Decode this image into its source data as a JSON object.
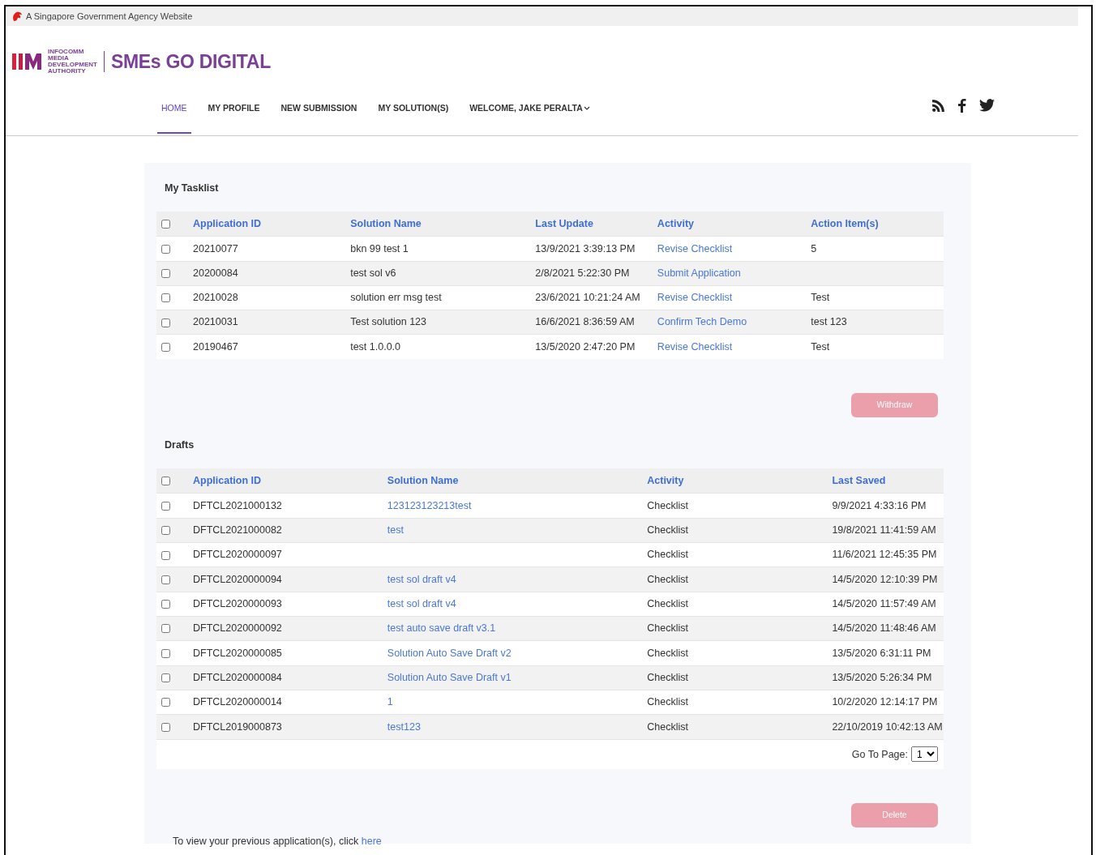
{
  "gov_bar": {
    "text": "A Singapore Government Agency Website"
  },
  "logo": {
    "agency_lines": [
      "INFOCOMM",
      "MEDIA",
      "DEVELOPMENT",
      "AUTHORITY"
    ],
    "site_title": "SMEs GO DIGITAL"
  },
  "nav": [
    {
      "label": "HOME",
      "selected": true,
      "kind": "link"
    },
    {
      "label": "MY PROFILE",
      "selected": false,
      "kind": "link"
    },
    {
      "label": "NEW SUBMISSION",
      "selected": false,
      "kind": "link"
    },
    {
      "label": "MY SOLUTION(S)",
      "selected": false,
      "kind": "link"
    },
    {
      "label": "WELCOME, JAKE PERALTA",
      "selected": false,
      "kind": "dropdown"
    }
  ],
  "tasklist": {
    "title": "My Tasklist",
    "header_checked": false,
    "columns": [
      {
        "label": "Application ID",
        "kind": "text"
      },
      {
        "label": "Solution Name",
        "kind": "text"
      },
      {
        "label": "Last Update",
        "kind": "text"
      },
      {
        "label": "Activity",
        "kind": "link"
      },
      {
        "label": "Action Item(s)",
        "kind": "text"
      }
    ],
    "rows": [
      {
        "checked": false,
        "cells": [
          "20210077",
          "bkn 99 test 1",
          "13/9/2021 3:39:13 PM",
          "Revise Checklist",
          "5"
        ]
      },
      {
        "checked": false,
        "cells": [
          "20200084",
          "test sol v6",
          "2/8/2021 5:22:30 PM",
          "Submit Application",
          ""
        ]
      },
      {
        "checked": false,
        "cells": [
          "20210028",
          "solution err msg test",
          "23/6/2021 10:21:24 AM",
          "Revise Checklist",
          "Test"
        ]
      },
      {
        "checked": false,
        "cells": [
          "20210031",
          "Test solution 123",
          "16/6/2021 8:36:59 AM",
          "Confirm Tech Demo",
          "test 123"
        ]
      },
      {
        "checked": false,
        "cells": [
          "20190467",
          "test 1.0.0.0",
          "13/5/2020 2:47:20 PM",
          "Revise Checklist",
          "Test"
        ]
      }
    ],
    "button": {
      "label": "Withdraw",
      "disabled": true
    }
  },
  "drafts": {
    "title": "Drafts",
    "header_checked": false,
    "columns": [
      {
        "label": "Application ID",
        "kind": "text"
      },
      {
        "label": "Solution Name",
        "kind": "link"
      },
      {
        "label": "Activity",
        "kind": "text"
      },
      {
        "label": "Last Saved",
        "kind": "text"
      }
    ],
    "rows": [
      {
        "checked": false,
        "cells": [
          "DFTCL2021000132",
          "123123123213test",
          "Checklist",
          "9/9/2021 4:33:16 PM"
        ]
      },
      {
        "checked": false,
        "cells": [
          "DFTCL2021000082",
          "test",
          "Checklist",
          "19/8/2021 11:41:59 AM"
        ]
      },
      {
        "checked": false,
        "cells": [
          "DFTCL2020000097",
          "",
          "Checklist",
          "11/6/2021 12:45:35 PM"
        ]
      },
      {
        "checked": false,
        "cells": [
          "DFTCL2020000094",
          "test sol draft v4",
          "Checklist",
          "14/5/2020 12:10:39 PM"
        ]
      },
      {
        "checked": false,
        "cells": [
          "DFTCL2020000093",
          "test sol draft v4",
          "Checklist",
          "14/5/2020 11:57:49 AM"
        ]
      },
      {
        "checked": false,
        "cells": [
          "DFTCL2020000092",
          "test auto save draft v3.1",
          "Checklist",
          "14/5/2020 11:48:46 AM"
        ]
      },
      {
        "checked": false,
        "cells": [
          "DFTCL2020000085",
          "Solution Auto Save Draft v2",
          "Checklist",
          "13/5/2020 6:31:11 PM"
        ]
      },
      {
        "checked": false,
        "cells": [
          "DFTCL2020000084",
          "Solution Auto Save Draft v1",
          "Checklist",
          "13/5/2020 5:26:34 PM"
        ]
      },
      {
        "checked": false,
        "cells": [
          "DFTCL2020000014",
          "1",
          "Checklist",
          "10/2/2020 12:14:17 PM"
        ]
      },
      {
        "checked": false,
        "cells": [
          "DFTCL2019000873",
          "test123",
          "Checklist",
          "22/10/2019 10:42:13 AM"
        ]
      }
    ],
    "pager": {
      "label": "Go To Page:",
      "value": "1"
    },
    "button": {
      "label": "Delete",
      "disabled": true
    }
  },
  "footer_note": {
    "text": "To view your previous application(s), click ",
    "link": "here"
  }
}
